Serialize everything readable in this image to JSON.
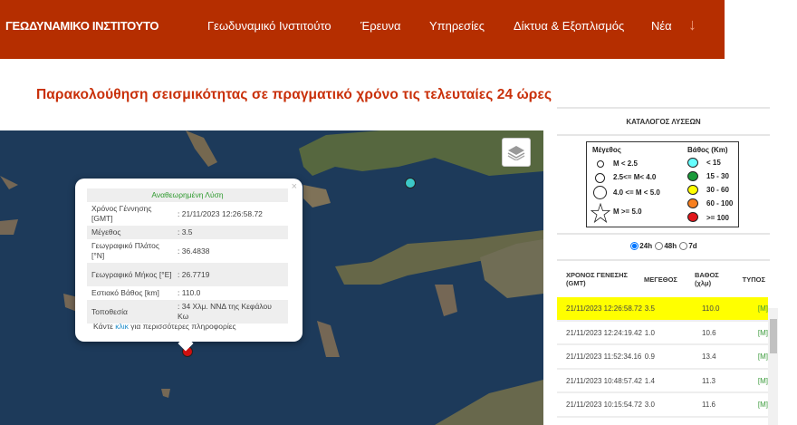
{
  "header": {
    "brand": "ΓΕΩΔΥΝΑΜΙΚΟ ΙΝΣΤΙΤΟΥΤΟ",
    "nav": [
      "Γεωδυναμικό Ινστιτούτο",
      "Έρευνα",
      "Υπηρεσίες",
      "Δίκτυα & Εξοπλισμός",
      "Νέα"
    ],
    "more_icon": "arrow-down-icon"
  },
  "page_title": "Παρακολούθηση σεισμικότητας σε πραγματικό χρόνο τις τελευταίες 24 ώρες",
  "popup": {
    "heading": "Αναθεωρημένη Λύση",
    "rows": [
      {
        "label": "Χρόνος Γέννησης [GMT]",
        "value": ": 21/11/2023 12:26:58.72"
      },
      {
        "label": "Μέγεθος",
        "value": ": 3.5"
      },
      {
        "label": "Γεωγραφικό Πλάτος [°N]",
        "value": ": 36.4838"
      },
      {
        "label": "Γεωγραφικό Μήκος [°E]",
        "value": ": 26.7719"
      },
      {
        "label": "Εστιακό Βάθος [km]",
        "value": ": 110.0"
      },
      {
        "label": "Τοποθεσία",
        "value": ": 34 Χλμ. ΝΝΔ της Κεφάλου Κω"
      }
    ],
    "more_prefix": "Κάντε ",
    "more_link": "κλικ",
    "more_suffix": " για περισσότερες πληροφορίες",
    "close": "×"
  },
  "panel": {
    "title": "ΚΑΤΑΛΟΓΟΣ ΛΥΣΕΩΝ",
    "legend": {
      "mag_title": "Μέγεθος",
      "mags": [
        "M < 2.5",
        "2.5<= M< 4.0",
        "4.0 <= M < 5.0",
        "M >= 5.0"
      ],
      "depth_title": "Βάθος (Km)",
      "depths": [
        "< 15",
        "15 - 30",
        "30 - 60",
        "60 - 100",
        ">= 100"
      ],
      "depth_colors": [
        "#6ff",
        "#1a9a3a",
        "#ff0",
        "#f77f1f",
        "#e0161b"
      ]
    },
    "ranges": [
      "24h",
      "48h",
      "7d"
    ],
    "selected_range": "24h",
    "columns": [
      "ΧΡΟΝΟΣ ΓΕΝΕΣΗΣ (GMT)",
      "ΜΕΓΕΘΟΣ",
      "ΒΑΘΟΣ (χλμ)",
      "ΤΥΠΟΣ"
    ],
    "rows": [
      [
        "21/11/2023 12:26:58.72",
        "3.5",
        "110.0",
        "[M]"
      ],
      [
        "21/11/2023 12:24:19.42",
        "1.0",
        "10.6",
        "[M]"
      ],
      [
        "21/11/2023 11:52:34.16",
        "0.9",
        "13.4",
        "[M]"
      ],
      [
        "21/11/2023 10:48:57.42",
        "1.4",
        "11.3",
        "[M]"
      ],
      [
        "21/11/2023 10:15:54.72",
        "3.0",
        "11.6",
        "[M]"
      ]
    ]
  }
}
